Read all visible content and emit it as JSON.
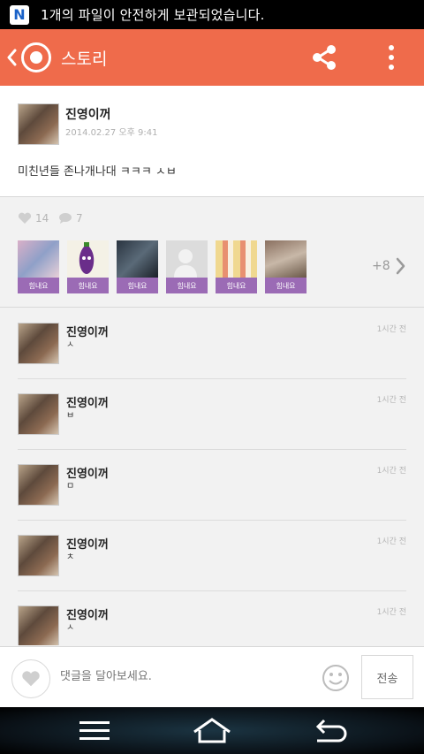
{
  "statusbar": {
    "app_icon": "N",
    "notification": "1개의 파일이 안전하게 보관되었습니다."
  },
  "appbar": {
    "title": "스토리",
    "back_icon": "chevron-left-icon",
    "share_icon": "share-icon",
    "more_icon": "more-vertical-icon",
    "color": "#ef6b4b"
  },
  "post": {
    "author": "진영이꺼",
    "date": "2014.02.27 오후 9:41",
    "text": "미친년들 존나개나대 ㅋㅋㅋ ㅅㅂ"
  },
  "stats": {
    "likes": "14",
    "comments": "7",
    "more_count": "+8",
    "sharers": [
      {
        "tag": "힘내요",
        "color": "#c79ab8"
      },
      {
        "tag": "힘내요",
        "color": "#6a2d8a"
      },
      {
        "tag": "힘내요",
        "color": "#3a4450"
      },
      {
        "tag": "힘내요",
        "color": "#cfcfcf"
      },
      {
        "tag": "힘내요",
        "color": "#e8c070"
      },
      {
        "tag": "힘내요",
        "color": "#a89080"
      }
    ],
    "tag_color": "#9b6bb5"
  },
  "comments": [
    {
      "name": "진영이꺼",
      "text": "ㅅ",
      "time": "1시간 전"
    },
    {
      "name": "진영이꺼",
      "text": "ㅂ",
      "time": "1시간 전"
    },
    {
      "name": "진영이꺼",
      "text": "ㅁ",
      "time": "1시간 전"
    },
    {
      "name": "진영이꺼",
      "text": "ㅊ",
      "time": "1시간 전"
    },
    {
      "name": "진영이꺼",
      "text": "ㅅ",
      "time": "1시간 전"
    }
  ],
  "input": {
    "placeholder": "댓글을 달아보세요.",
    "send_label": "전송"
  },
  "navbar": {
    "icons": [
      "menu-icon",
      "home-icon",
      "back-icon"
    ]
  }
}
